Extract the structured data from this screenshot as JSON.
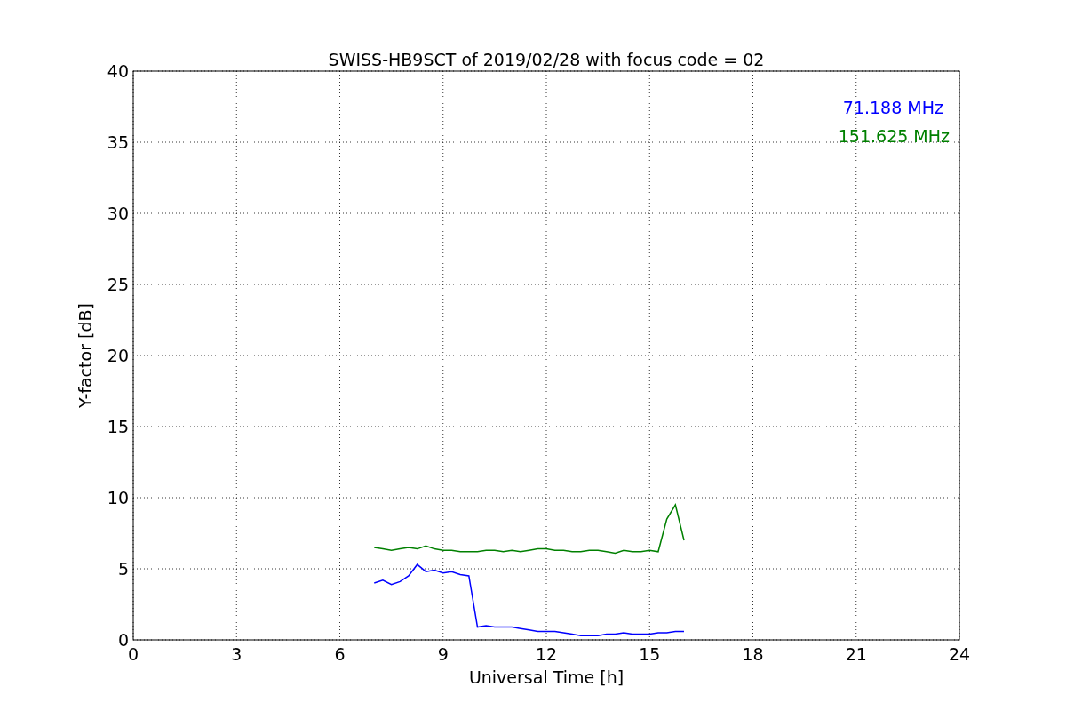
{
  "figure": {
    "chart_data": {
      "type": "line",
      "grid": true,
      "title": "SWISS-HB9SCT of 2019/02/28 with focus code = 02",
      "xlabel": "Universal Time [h]",
      "ylabel": "Y-factor [dB]",
      "xlim": [
        0,
        24
      ],
      "ylim": [
        0,
        40
      ],
      "xticks": [
        0,
        3,
        6,
        9,
        12,
        15,
        18,
        21,
        24
      ],
      "yticks": [
        0,
        5,
        10,
        15,
        20,
        25,
        30,
        35,
        40
      ],
      "x": [
        7,
        7.25,
        7.5,
        7.75,
        8,
        8.25,
        8.5,
        8.75,
        9,
        9.25,
        9.5,
        9.75,
        10,
        10.25,
        10.5,
        10.75,
        11,
        11.25,
        11.5,
        11.75,
        12,
        12.25,
        12.5,
        12.75,
        13,
        13.25,
        13.5,
        13.75,
        14,
        14.25,
        14.5,
        14.75,
        15,
        15.25,
        15.5,
        15.75,
        16
      ],
      "series": [
        {
          "name": "71.188 MHz",
          "color": "#0000ff",
          "values": [
            4.0,
            4.2,
            3.9,
            4.1,
            4.5,
            5.3,
            4.8,
            4.9,
            4.7,
            4.8,
            4.6,
            4.5,
            0.9,
            1.0,
            0.9,
            0.9,
            0.9,
            0.8,
            0.7,
            0.6,
            0.6,
            0.6,
            0.5,
            0.4,
            0.3,
            0.3,
            0.3,
            0.4,
            0.4,
            0.5,
            0.4,
            0.4,
            0.4,
            0.5,
            0.5,
            0.6,
            0.6
          ]
        },
        {
          "name": "151.625 MHz",
          "color": "#008000",
          "values": [
            6.5,
            6.4,
            6.3,
            6.4,
            6.5,
            6.4,
            6.6,
            6.4,
            6.3,
            6.3,
            6.2,
            6.2,
            6.2,
            6.3,
            6.3,
            6.2,
            6.3,
            6.2,
            6.3,
            6.4,
            6.4,
            6.3,
            6.3,
            6.2,
            6.2,
            6.3,
            6.3,
            6.2,
            6.1,
            6.3,
            6.2,
            6.2,
            6.3,
            6.2,
            8.5,
            9.5,
            7.0
          ]
        }
      ]
    }
  }
}
